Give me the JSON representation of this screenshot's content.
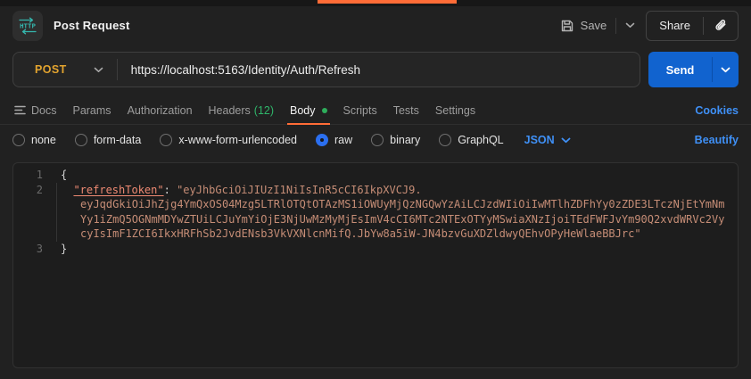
{
  "colors": {
    "accent_orange": "#ff6c37",
    "method_post_yellow": "#e3a42f",
    "send_button_blue": "#1163cf",
    "link_blue": "#3f90f6",
    "success_green": "#2fb56a",
    "http_icon_teal": "#35b7ae",
    "json_key_salmon": "#ef8a73",
    "json_string_tan": "#c68d76",
    "background": "#212121"
  },
  "icons": {
    "http_badge": "http-request-icon",
    "save": "floppy-disk-icon",
    "save_caret": "chevron-down-icon",
    "share_link": "paperclip-icon",
    "docs": "list-icon",
    "method_caret": "chevron-down-icon",
    "send_caret": "chevron-down-icon",
    "language_caret": "chevron-down-icon"
  },
  "header": {
    "http_badge_text": "HTTP",
    "title": "Post Request",
    "save_label": "Save",
    "share_label": "Share"
  },
  "request": {
    "method": "POST",
    "url": "https://localhost:5163/Identity/Auth/Refresh",
    "send_label": "Send"
  },
  "tabs": {
    "items": [
      {
        "label": "Docs"
      },
      {
        "label": "Params"
      },
      {
        "label": "Authorization"
      },
      {
        "label": "Headers",
        "count": "(12)"
      },
      {
        "label": "Body",
        "active": true,
        "has_unsaved_dot": true
      },
      {
        "label": "Scripts"
      },
      {
        "label": "Tests"
      },
      {
        "label": "Settings"
      }
    ],
    "cookies_link": "Cookies"
  },
  "body_options": {
    "modes": [
      "none",
      "form-data",
      "x-www-form-urlencoded",
      "raw",
      "binary",
      "GraphQL"
    ],
    "selected_mode": "raw",
    "language": "JSON",
    "beautify_link": "Beautify"
  },
  "editor": {
    "line_numbers": [
      "1",
      "2",
      "3"
    ],
    "line1_open_brace": "{",
    "line2_key": "\"refreshToken\"",
    "line2_colon": ": ",
    "token_vline1": "\"eyJhbGciOiJIUzI1NiIsInR5cCI6IkpXVCJ9.",
    "token_vline2": "eyJqdGkiOiJhZjg4YmQxOS04Mzg5LTRlOTQtOTAzMS1iOWUyMjQzNGQwYzAiLCJzdWIiOiIwMTlhZDFhYy0zZDE3LTczNjEtYmNm",
    "token_vline3": "Yy1iZmQ5OGNmMDYwZTUiLCJuYmYiOjE3NjUwMzMyMjEsImV4cCI6MTc2NTExOTYyMSwiaXNzIjoiTEdFWFJvYm90Q2xvdWRVc2Vy",
    "token_vline4": "cyIsImF1ZCI6IkxHRFhSb2JvdENsb3VkVXNlcnMifQ.JbYw8a5iW-JN4bzvGuXDZldwyQEhvOPyHeWlaeBBJrc\"",
    "line3_close_brace": "}"
  }
}
